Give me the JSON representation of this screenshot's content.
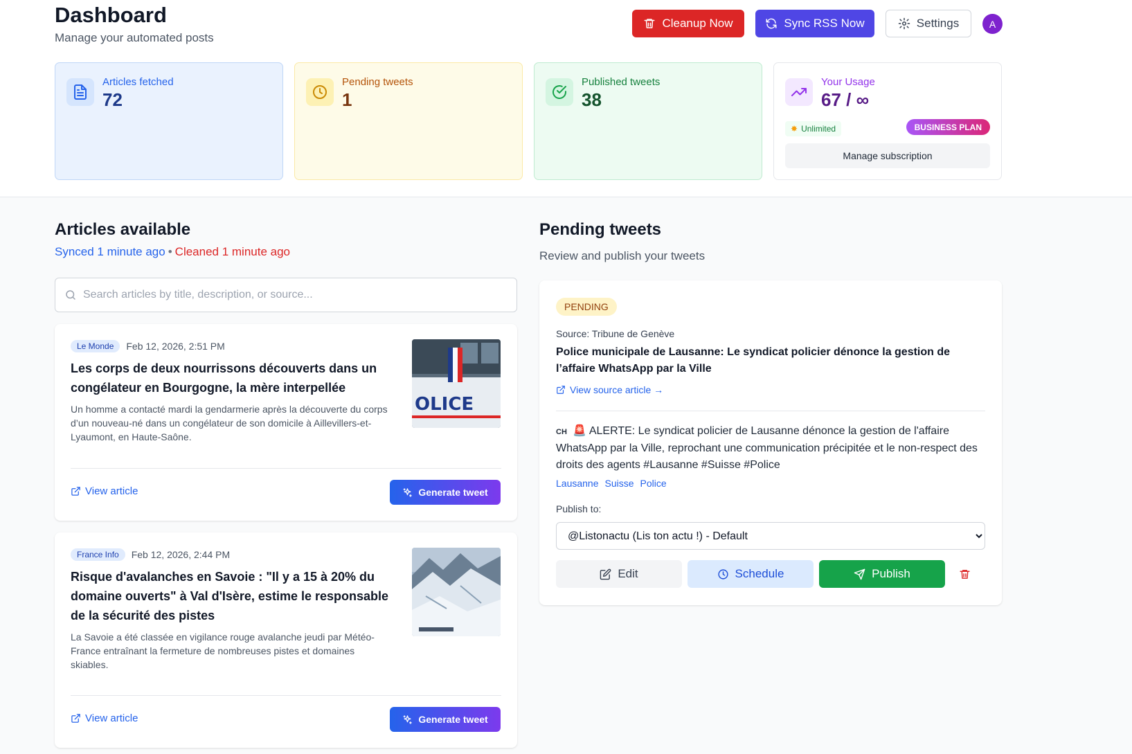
{
  "header": {
    "title": "Dashboard",
    "subtitle": "Manage your automated posts",
    "cleanup_label": "Cleanup Now",
    "sync_label": "Sync RSS Now",
    "settings_label": "Settings",
    "avatar_initial": "A"
  },
  "stats": {
    "articles": {
      "label": "Articles fetched",
      "value": "72"
    },
    "pending": {
      "label": "Pending tweets",
      "value": "1"
    },
    "published": {
      "label": "Published tweets",
      "value": "38"
    },
    "usage": {
      "label": "Your Usage",
      "value": "67 / ∞",
      "limit_badge": "Unlimited",
      "plan_badge": "BUSINESS PLAN",
      "manage_label": "Manage subscription"
    }
  },
  "articles_section": {
    "title": "Articles available",
    "synced": "Synced 1 minute ago",
    "separator": "•",
    "cleaned": "Cleaned 1 minute ago",
    "search_placeholder": "Search articles by title, description, or source...",
    "view_label": "View article",
    "generate_label": "Generate tweet",
    "items": [
      {
        "source": "Le Monde",
        "date": "Feb 12, 2026, 2:51 PM",
        "title": "Les corps de deux nourrissons découverts dans un congélateur en Bourgogne, la mère interpellée",
        "description": "Un homme a contacté mardi la gendarmerie après la découverte du corps d’un nouveau-né dans un congélateur de son domicile à Aillevillers-et-Lyaumont, en Haute-Saône.",
        "thumb_text": "OLICE"
      },
      {
        "source": "France Info",
        "date": "Feb 12, 2026, 2:44 PM",
        "title": "Risque d'avalanches en Savoie : \"Il y a 15 à 20% du domaine ouverts\" à Val d'Isère, estime le responsable de la sécurité des pistes",
        "description": "La Savoie a été classée en vigilance rouge avalanche jeudi par Météo-France entraînant la fermeture de nombreuses pistes et domaines skiables."
      }
    ]
  },
  "pending_section": {
    "title": "Pending tweets",
    "subtitle": "Review and publish your tweets",
    "tweet": {
      "status": "PENDING",
      "source": "Source: Tribune de Genève",
      "title": "Police municipale de Lausanne: Le syndicat policier dénonce la gestion de l’affaire WhatsApp par la Ville",
      "source_link": "View source article →",
      "flag": "CH",
      "emoji": "🚨",
      "text": "ALERTE: Le syndicat policier de Lausanne dénonce la gestion de l'affaire WhatsApp par la Ville, reprochant une communication précipitée et le non-respect des droits des agents #Lausanne #Suisse #Police",
      "hashtags": [
        "Lausanne",
        "Suisse",
        "Police"
      ],
      "publish_to_label": "Publish to:",
      "selected_account": "@Listonactu (Lis ton actu !) - Default",
      "edit_label": "Edit",
      "schedule_label": "Schedule",
      "publish_label": "Publish"
    }
  },
  "colors": {
    "cleanup": "#dc2626",
    "sync": "#4f46e5",
    "publish": "#16a34a",
    "link": "#2563eb"
  }
}
